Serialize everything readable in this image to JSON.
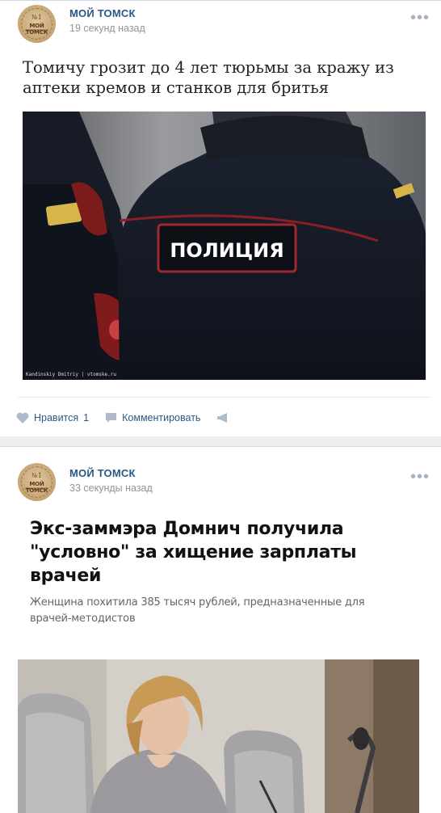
{
  "posts": [
    {
      "author": "МОЙ ТОМСК",
      "time": "19 секунд назад",
      "avatar": {
        "num": "№1",
        "text": "МОЙ ТОМСК"
      },
      "title": "Томичу грозит до 4 лет тюрьмы за кражу из аптеки кремов и станков для бритья",
      "photo": {
        "patch_text": "ПОЛИЦИЯ",
        "caption": "Kandinskiy Dmitriy | vtomske.ru"
      },
      "actions": {
        "like_label": "Нравится",
        "like_count": "1",
        "comment_label": "Комментировать"
      }
    },
    {
      "author": "МОЙ ТОМСК",
      "time": "33 секунды назад",
      "avatar": {
        "num": "№1",
        "text": "МОЙ ТОМСК"
      },
      "card_title": "Экс-заммэра Домнич получила \"условно\" за хищение зарплаты врачей",
      "card_subtitle": "Женщина похитила 385 тысяч рублей, предназначенные для врачей-методистов"
    }
  ],
  "colors": {
    "link": "#2a5885",
    "meta": "#939393",
    "background": "#edeef0"
  },
  "icons": {
    "more": "more-dots-icon",
    "like": "heart-icon",
    "comment": "comment-icon",
    "share": "megaphone-icon"
  }
}
